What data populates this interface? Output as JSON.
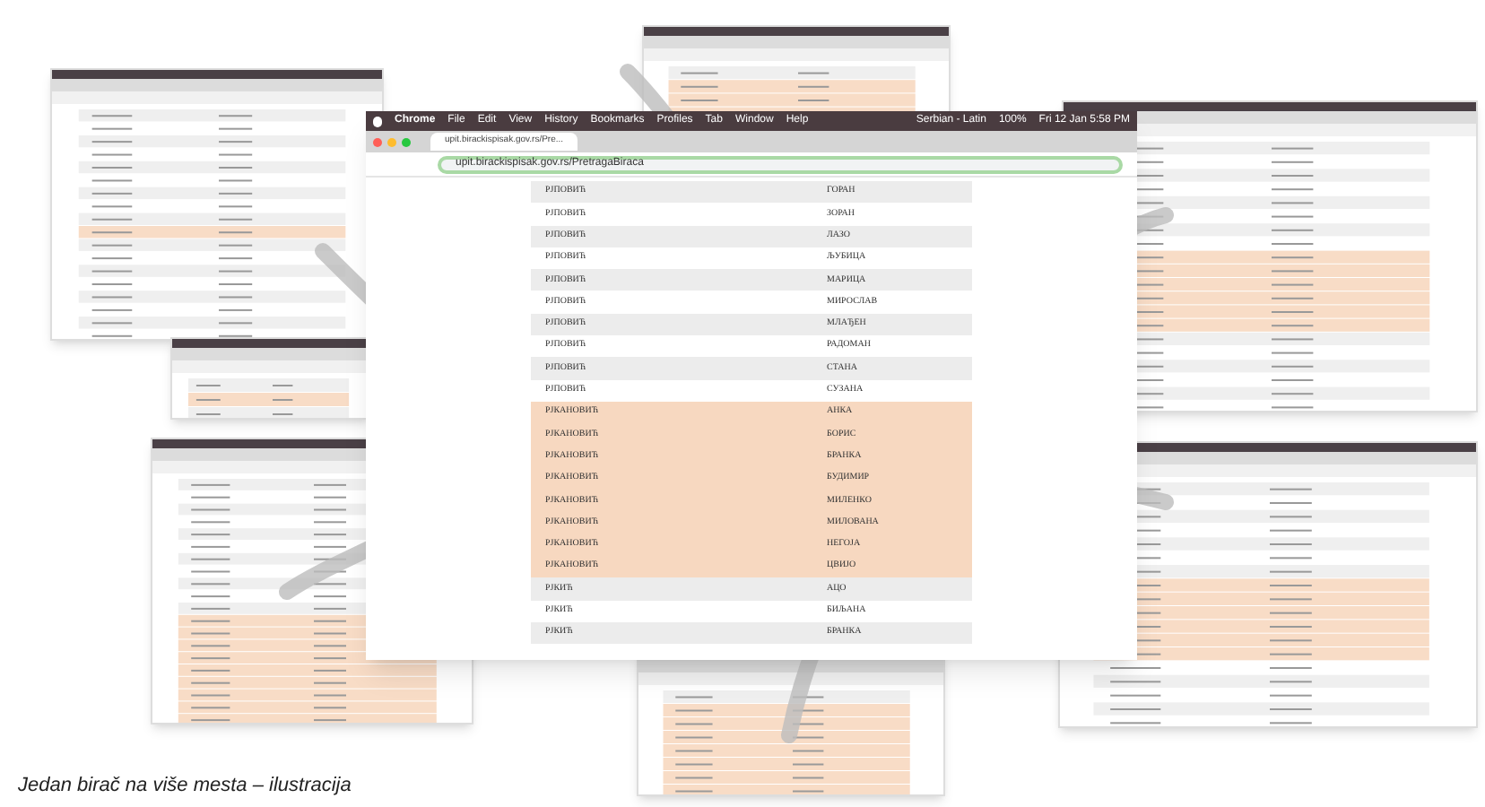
{
  "menu_bar": {
    "items": [
      "Chrome",
      "File",
      "Edit",
      "View",
      "History",
      "Bookmarks",
      "Profiles",
      "Tab",
      "Window",
      "Help"
    ],
    "status": [
      "Serbian - Latin",
      "100%",
      "Fri 12 Jan  5:58 PM"
    ]
  },
  "tab": {
    "title": "upit.birackispisak.gov.rs/Pre..."
  },
  "address_bar": {
    "value": "upit.birackispisak.gov.rs/PretragaBiraca"
  },
  "rows": [
    {
      "surname": "РЈПОВИЋ",
      "name": "ГОРАН",
      "highlighted": false
    },
    {
      "surname": "РЈПОВИЋ",
      "name": "ЗОРАН",
      "highlighted": false
    },
    {
      "surname": "РЈПОВИЋ",
      "name": "ЛАЗО",
      "highlighted": false
    },
    {
      "surname": "РЈПОВИЋ",
      "name": "ЉУБИЦА",
      "highlighted": false
    },
    {
      "surname": "РЈПОВИЋ",
      "name": "МАРИЦА",
      "highlighted": false
    },
    {
      "surname": "РЈПОВИЋ",
      "name": "МИРОСЛАВ",
      "highlighted": false
    },
    {
      "surname": "РЈПОВИЋ",
      "name": "МЛАЂЕН",
      "highlighted": false
    },
    {
      "surname": "РЈПОВИЋ",
      "name": "РАДОМАН",
      "highlighted": false
    },
    {
      "surname": "РЈПОВИЋ",
      "name": "СТАНА",
      "highlighted": false
    },
    {
      "surname": "РЈПОВИЋ",
      "name": "СУЗАНА",
      "highlighted": false
    },
    {
      "surname": "РЈКАНОВИЋ",
      "name": "АНКА",
      "highlighted": true
    },
    {
      "surname": "РЈКАНОВИЋ",
      "name": "БОРИС",
      "highlighted": true
    },
    {
      "surname": "РЈКАНОВИЋ",
      "name": "БРАНКА",
      "highlighted": true
    },
    {
      "surname": "РЈКАНОВИЋ",
      "name": "БУДИМИР",
      "highlighted": true
    },
    {
      "surname": "РЈКАНОВИЋ",
      "name": "МИЛЕНКО",
      "highlighted": true
    },
    {
      "surname": "РЈКАНОВИЋ",
      "name": "МИЛОВАНА",
      "highlighted": true
    },
    {
      "surname": "РЈКАНОВИЋ",
      "name": "НЕГОЈА",
      "highlighted": true
    },
    {
      "surname": "РЈКАНОВИЋ",
      "name": "ЦВИЈО",
      "highlighted": true
    },
    {
      "surname": "РЈКИЋ",
      "name": "АЦО",
      "highlighted": false
    },
    {
      "surname": "РЈКИЋ",
      "name": "БИЉАНА",
      "highlighted": false
    },
    {
      "surname": "РЈКИЋ",
      "name": "БРАНКА",
      "highlighted": false
    }
  ],
  "caption": "Jedan birač na više mesta – ilustracija"
}
